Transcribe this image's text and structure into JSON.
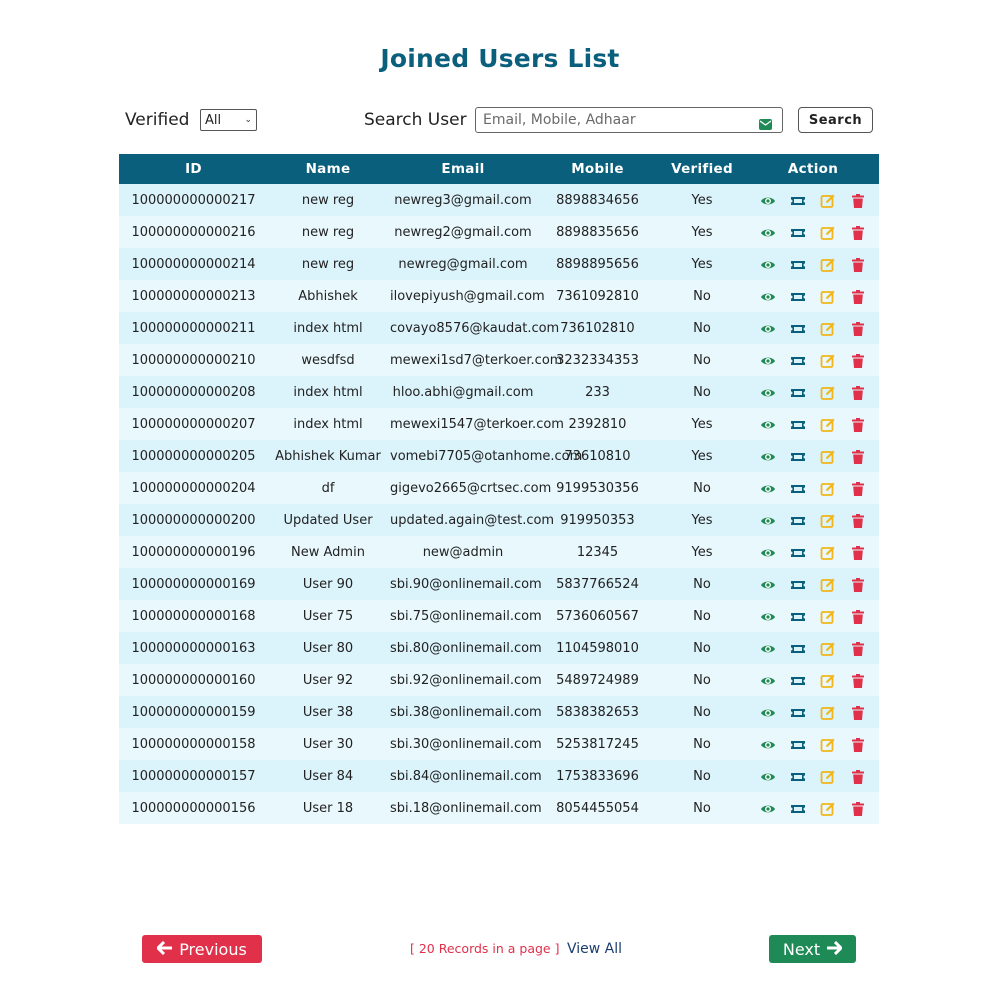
{
  "page": {
    "title": "Joined Users List"
  },
  "filters": {
    "verified_label": "Verified",
    "verified_value": "All",
    "search_label": "Search User",
    "search_placeholder": "Email, Mobile, Adhaar",
    "search_value": "",
    "search_button": "Search"
  },
  "table": {
    "headers": [
      "ID",
      "Name",
      "Email",
      "Mobile",
      "Verified",
      "Action"
    ],
    "rows": [
      {
        "id": "100000000000217",
        "name": "new reg",
        "email": "newreg3@gmail.com",
        "mobile": "8898834656",
        "verified": "Yes"
      },
      {
        "id": "100000000000216",
        "name": "new reg",
        "email": "newreg2@gmail.com",
        "mobile": "8898835656",
        "verified": "Yes"
      },
      {
        "id": "100000000000214",
        "name": "new reg",
        "email": "newreg@gmail.com",
        "mobile": "8898895656",
        "verified": "Yes"
      },
      {
        "id": "100000000000213",
        "name": "Abhishek",
        "email": "ilovepiyush@gmail.com",
        "mobile": "7361092810",
        "verified": "No"
      },
      {
        "id": "100000000000211",
        "name": "index html",
        "email": "covayo8576@kaudat.com",
        "mobile": "736102810",
        "verified": "No"
      },
      {
        "id": "100000000000210",
        "name": "wesdfsd",
        "email": "mewexi1sd7@terkoer.com",
        "mobile": "3232334353",
        "verified": "No"
      },
      {
        "id": "100000000000208",
        "name": "index html",
        "email": "hloo.abhi@gmail.com",
        "mobile": "233",
        "verified": "No"
      },
      {
        "id": "100000000000207",
        "name": "index html",
        "email": "mewexi1547@terkoer.com",
        "mobile": "2392810",
        "verified": "Yes"
      },
      {
        "id": "100000000000205",
        "name": "Abhishek Kumar",
        "email": "vomebi7705@otanhome.com",
        "mobile": "73610810",
        "verified": "Yes"
      },
      {
        "id": "100000000000204",
        "name": "df",
        "email": "gigevo2665@crtsec.com",
        "mobile": "9199530356",
        "verified": "No"
      },
      {
        "id": "100000000000200",
        "name": "Updated User",
        "email": "updated.again@test.com",
        "mobile": "919950353",
        "verified": "Yes"
      },
      {
        "id": "100000000000196",
        "name": "New Admin",
        "email": "new@admin",
        "mobile": "12345",
        "verified": "Yes"
      },
      {
        "id": "100000000000169",
        "name": "User 90",
        "email": "sbi.90@onlinemail.com",
        "mobile": "5837766524",
        "verified": "No"
      },
      {
        "id": "100000000000168",
        "name": "User 75",
        "email": "sbi.75@onlinemail.com",
        "mobile": "5736060567",
        "verified": "No"
      },
      {
        "id": "100000000000163",
        "name": "User 80",
        "email": "sbi.80@onlinemail.com",
        "mobile": "1104598010",
        "verified": "No"
      },
      {
        "id": "100000000000160",
        "name": "User 92",
        "email": "sbi.92@onlinemail.com",
        "mobile": "5489724989",
        "verified": "No"
      },
      {
        "id": "100000000000159",
        "name": "User 38",
        "email": "sbi.38@onlinemail.com",
        "mobile": "5838382653",
        "verified": "No"
      },
      {
        "id": "100000000000158",
        "name": "User 30",
        "email": "sbi.30@onlinemail.com",
        "mobile": "5253817245",
        "verified": "No"
      },
      {
        "id": "100000000000157",
        "name": "User 84",
        "email": "sbi.84@onlinemail.com",
        "mobile": "1753833696",
        "verified": "No"
      },
      {
        "id": "100000000000156",
        "name": "User 18",
        "email": "sbi.18@onlinemail.com",
        "mobile": "8054455054",
        "verified": "No"
      }
    ],
    "action_icons": [
      "eye-icon",
      "ticket-icon",
      "edit-icon",
      "trash-icon"
    ]
  },
  "pagination": {
    "previous_label": "Previous",
    "records_note": "[ 20 Records in a page ]",
    "view_all_label": "View All",
    "next_label": "Next"
  },
  "colors": {
    "header_bg": "#0a5f7d",
    "title": "#0a5f7d",
    "view_icon": "#1e8a55",
    "ticket_icon": "#0a5f7d",
    "edit_icon": "#f2b51c",
    "delete_icon": "#e0304a",
    "previous_bg": "#e0304a",
    "next_bg": "#1e8a55"
  }
}
